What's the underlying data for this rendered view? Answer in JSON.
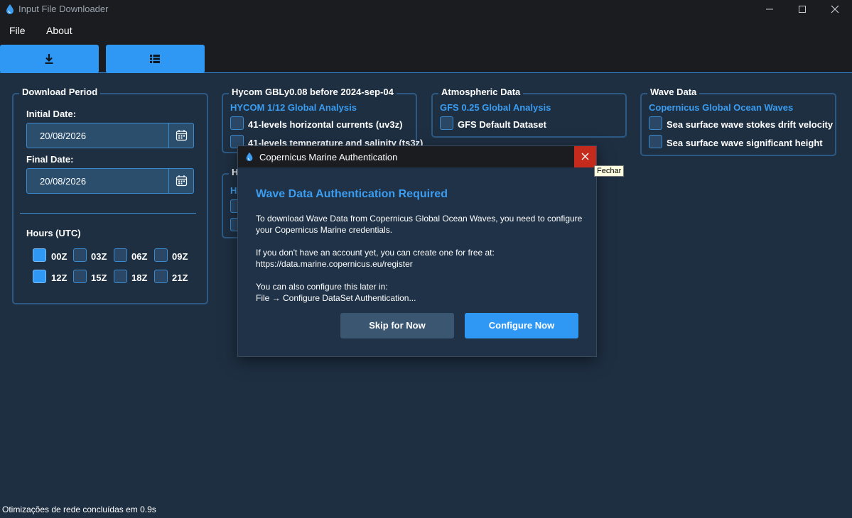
{
  "window": {
    "title": "Input File Downloader"
  },
  "menu": {
    "items": [
      "File",
      "About"
    ]
  },
  "toolbar": {
    "download_icon": "download-icon",
    "list_icon": "list-icon",
    "accent": "#2f98f5"
  },
  "download_period": {
    "title": "Download Period",
    "initial_label": "Initial Date:",
    "initial_value": "20/08/2026",
    "final_label": "Final Date:",
    "final_value": "20/08/2026",
    "hours_label": "Hours (UTC)",
    "hours": [
      {
        "label": "00Z",
        "checked": true
      },
      {
        "label": "03Z",
        "checked": false
      },
      {
        "label": "06Z",
        "checked": false
      },
      {
        "label": "09Z",
        "checked": false
      },
      {
        "label": "12Z",
        "checked": true
      },
      {
        "label": "15Z",
        "checked": false
      },
      {
        "label": "18Z",
        "checked": false
      },
      {
        "label": "21Z",
        "checked": false
      }
    ]
  },
  "hycom": {
    "title": "Hycom GBLy0.08 before 2024-sep-04",
    "subtitle": "HYCOM 1/12 Global Analysis",
    "items": [
      "41-levels horizontal currents (uv3z)",
      "41-levels temperature and salinity (ts3z)"
    ]
  },
  "hycom2": {
    "title": "H",
    "subtitle": "H"
  },
  "atmospheric": {
    "title": "Atmospheric Data",
    "subtitle": "GFS 0.25 Global Analysis",
    "items": [
      "GFS Default Dataset"
    ]
  },
  "wave": {
    "title": "Wave Data",
    "subtitle": "Copernicus Global Ocean Waves",
    "items": [
      "Sea surface wave stokes drift velocity",
      "Sea surface wave significant height"
    ]
  },
  "dialog": {
    "title": "Copernicus Marine Authentication",
    "heading": "Wave Data Authentication Required",
    "lines": [
      "To download Wave Data from Copernicus Global Ocean Waves, you need to configure",
      "your Copernicus Marine credentials.",
      "If you don't have an account yet, you can create one for free at:",
      "https://data.marine.copernicus.eu/register",
      "You can also configure this later in:",
      "File → Configure DataSet Authentication..."
    ],
    "skip_label": "Skip for Now",
    "configure_label": "Configure Now",
    "close_tooltip": "Fechar",
    "close_color": "#c42b1c"
  },
  "status": {
    "text": "Otimizações de rede concluídas em 0.9s"
  }
}
